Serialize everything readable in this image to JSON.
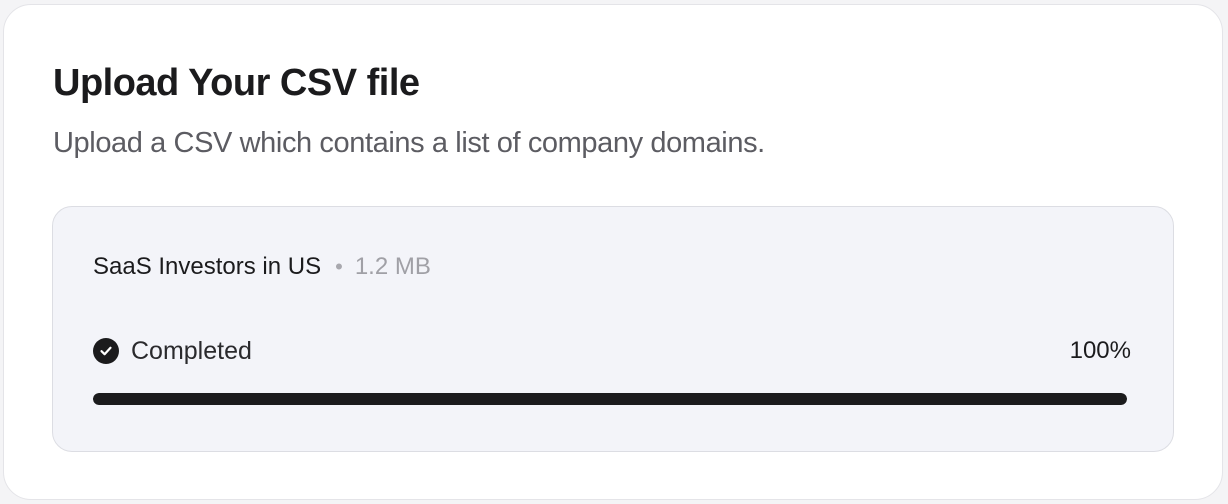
{
  "card": {
    "title": "Upload Your CSV file",
    "subtitle": "Upload a CSV which contains a list of company domains."
  },
  "file": {
    "name": "SaaS Investors in US",
    "separator": "•",
    "size": "1.2 MB",
    "status_icon": "check-circle-icon",
    "status": "Completed",
    "progress_label": "100%",
    "progress": 1.0
  },
  "colors": {
    "accent": "#1b1b1d",
    "panel_bg": "#f3f4f9"
  }
}
